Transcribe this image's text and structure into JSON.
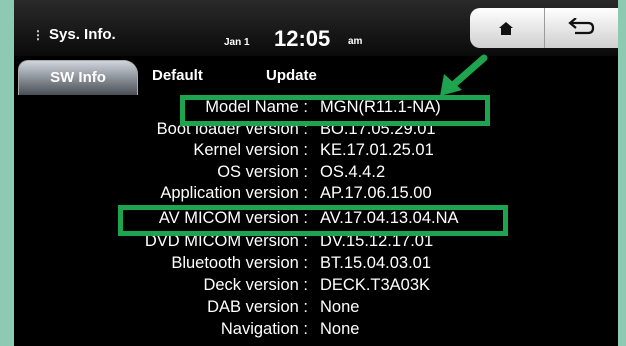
{
  "app": {
    "title": "Sys. Info.",
    "menu_icon": "vertical-dots-icon",
    "date": "Jan 1",
    "time": "12:05",
    "ampm": "am"
  },
  "buttons": {
    "home_icon": "home-icon",
    "back_icon": "back-arrow-icon"
  },
  "tabs": [
    {
      "label": "SW Info",
      "active": true
    },
    {
      "label": "Default",
      "active": false
    },
    {
      "label": "Update",
      "active": false
    }
  ],
  "info": [
    {
      "label": "Model Name :",
      "value": "MGN(R11.1-NA)"
    },
    {
      "label": "Boot loader version :",
      "value": "BO.17.05.29.01"
    },
    {
      "label": "Kernel version :",
      "value": "KE.17.01.25.01"
    },
    {
      "label": "OS version :",
      "value": "OS.4.4.2"
    },
    {
      "label": "Application version :",
      "value": "AP.17.06.15.00"
    },
    {
      "label": "AV MICOM version :",
      "value": "AV.17.04.13.04.NA"
    },
    {
      "label": "DVD MICOM version :",
      "value": "DV.15.12.17.01"
    },
    {
      "label": "Bluetooth version :",
      "value": "BT.15.04.03.01"
    },
    {
      "label": "Deck version :",
      "value": "DECK.T3A03K"
    },
    {
      "label": "DAB version :",
      "value": "None"
    },
    {
      "label": "Navigation :",
      "value": "None"
    }
  ],
  "annotations": {
    "highlight_color": "#1ea34f",
    "highlighted_rows": [
      "Model Name",
      "AV MICOM version"
    ],
    "pointer": "green-arrow-icon"
  }
}
